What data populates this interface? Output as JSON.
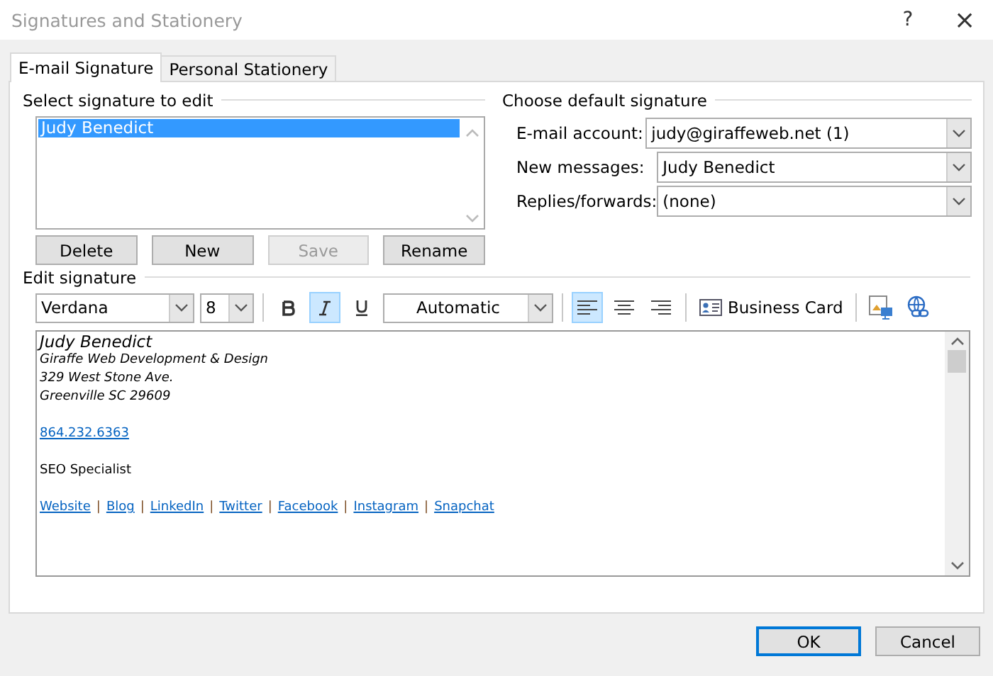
{
  "window": {
    "title": "Signatures and Stationery",
    "help": "?",
    "close": "×"
  },
  "tabs": [
    {
      "label": "E-mail Signature",
      "selected": true
    },
    {
      "label": "Personal Stationery",
      "selected": false
    }
  ],
  "select_signature": {
    "heading": "Select signature to edit",
    "items": [
      {
        "label": "Judy Benedict",
        "selected": true
      }
    ],
    "buttons": [
      {
        "label": "Delete",
        "disabled": false
      },
      {
        "label": "New",
        "disabled": false
      },
      {
        "label": "Save",
        "disabled": true
      },
      {
        "label": "Rename",
        "disabled": false
      }
    ]
  },
  "default_signature": {
    "heading": "Choose default signature",
    "fields": [
      {
        "label": "E-mail account:",
        "value": "judy@giraffeweb.net (1)"
      },
      {
        "label": "New messages:",
        "value": "Judy Benedict"
      },
      {
        "label": "Replies/forwards:",
        "value": "(none)"
      }
    ]
  },
  "edit_signature": {
    "heading": "Edit signature",
    "toolbar": [
      {
        "kind": "combo",
        "value": "Verdana"
      },
      {
        "kind": "combo",
        "value": "8"
      },
      {
        "kind": "sep"
      },
      {
        "kind": "bold",
        "selected": false
      },
      {
        "kind": "italic",
        "selected": true
      },
      {
        "kind": "underline",
        "selected": false
      },
      {
        "kind": "combo",
        "value": "Automatic"
      },
      {
        "kind": "sep"
      },
      {
        "kind": "alignleft",
        "selected": true
      },
      {
        "kind": "aligncenter",
        "selected": false
      },
      {
        "kind": "alignright",
        "selected": false
      },
      {
        "kind": "sep"
      },
      {
        "kind": "card",
        "label": "Business Card"
      },
      {
        "kind": "sep"
      },
      {
        "kind": "picture"
      },
      {
        "kind": "hyperlink"
      }
    ],
    "lines": [
      {
        "kind": "name",
        "text": "Judy Benedict"
      },
      {
        "kind": "italic",
        "text": "Giraffe Web Development & Design"
      },
      {
        "kind": "italic",
        "text": "329 West Stone Ave."
      },
      {
        "kind": "italic",
        "text": "Greenville SC 29609"
      },
      {
        "kind": "link",
        "text": "864.232.6363"
      },
      {
        "kind": "plain",
        "text": "SEO Specialist"
      },
      {
        "kind": "links",
        "separator": "|",
        "items": [
          "Website",
          "Blog",
          "LinkedIn",
          "Twitter",
          "Facebook",
          "Instagram",
          "Snapchat"
        ]
      }
    ]
  },
  "footer_buttons": [
    {
      "label": "OK",
      "selected": true
    },
    {
      "label": "Cancel",
      "selected": false
    }
  ]
}
